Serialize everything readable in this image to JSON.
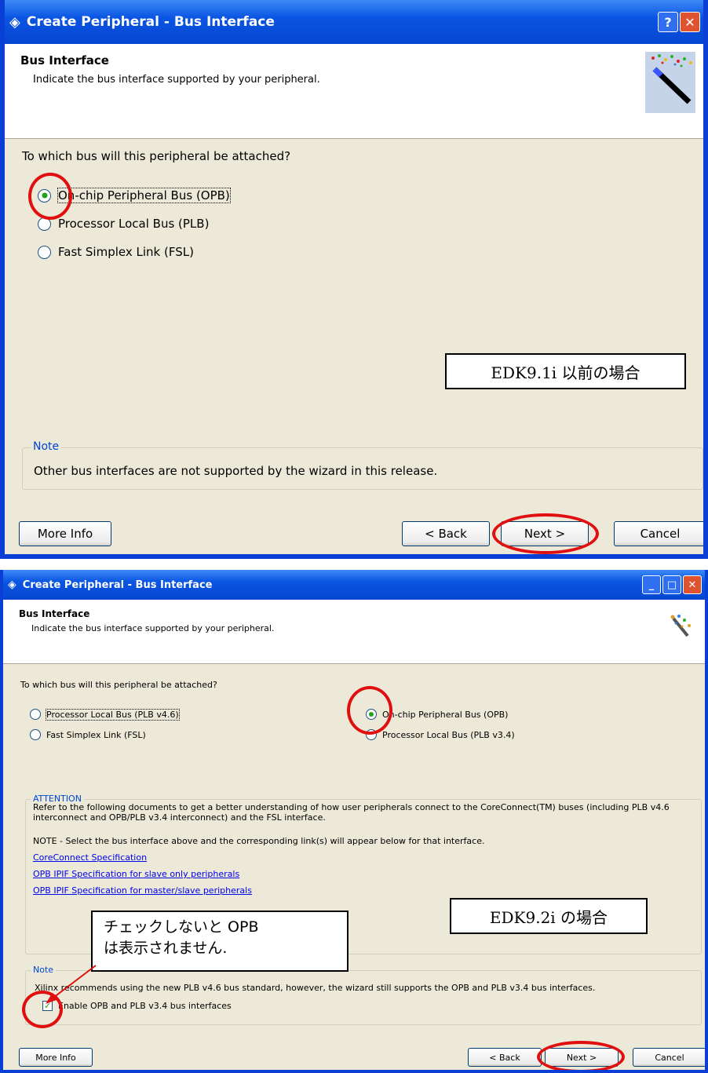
{
  "window1": {
    "title": "Create Peripheral - Bus Interface",
    "help_glyph": "?",
    "close_glyph": "✕",
    "header_title": "Bus Interface",
    "header_subtitle": "Indicate the bus interface supported by your peripheral.",
    "question": "To which bus will this peripheral be attached?",
    "options": [
      {
        "label": "On-chip Peripheral Bus (OPB)",
        "key": "O",
        "selected": true
      },
      {
        "label": "Processor Local Bus (PLB)",
        "key": "P",
        "selected": false
      },
      {
        "label": "Fast Simplex Link (FSL)",
        "key": "F",
        "selected": false
      }
    ],
    "note_legend": "Note",
    "note_text": "Other bus interfaces are not supported by the wizard in this release.",
    "buttons": {
      "more_info": "More Info",
      "back": "< Back",
      "next": "Next >",
      "cancel": "Cancel"
    },
    "annotation": "EDK9.1i 以前の場合"
  },
  "window2": {
    "title": "Create Peripheral - Bus Interface",
    "min_glyph": "_",
    "max_glyph": "□",
    "close_glyph": "✕",
    "header_title": "Bus Interface",
    "header_subtitle": "Indicate the bus interface supported by your peripheral.",
    "question": "To which bus will this peripheral be attached?",
    "options_left": [
      {
        "label": "Processor Local Bus (PLB v4.6)",
        "selected": false
      },
      {
        "label": "Fast Simplex Link (FSL)",
        "selected": false
      }
    ],
    "options_right": [
      {
        "label": "On-chip Peripheral Bus (OPB)",
        "selected": true
      },
      {
        "label": "Processor Local Bus (PLB v3.4)",
        "selected": false
      }
    ],
    "attention_legend": "ATTENTION",
    "attention_text": "Refer to the following documents to get a better understanding of how user peripherals connect to the CoreConnect(TM) buses (including PLB v4.6 interconnect and OPB/PLB v3.4 interconnect) and the FSL interface.",
    "attention_note": "NOTE - Select the bus interface above and the corresponding link(s) will appear below for that interface.",
    "links": [
      "CoreConnect Specification",
      "OPB IPIF Specification for slave only peripherals",
      "OPB IPIF Specification for master/slave peripherals"
    ],
    "note_legend": "Note",
    "note_text": "Xilinx recommends using the new PLB v4.6 bus standard, however, the wizard still supports the OPB and PLB v3.4 bus interfaces.",
    "checkbox_label": "Enable OPB and PLB v3.4 bus interfaces",
    "checkbox_checked": true,
    "buttons": {
      "more_info": "More Info",
      "back": "< Back",
      "next": "Next >",
      "cancel": "Cancel"
    },
    "annotation": "EDK9.2i の場合",
    "callout": [
      "チェックしないと OPB",
      "は表示されません."
    ]
  },
  "colors": {
    "xp_blue": "#0a55e2",
    "dialog_bg": "#ece9d8",
    "highlight_red": "#e01010",
    "link_blue": "#0000ee"
  }
}
